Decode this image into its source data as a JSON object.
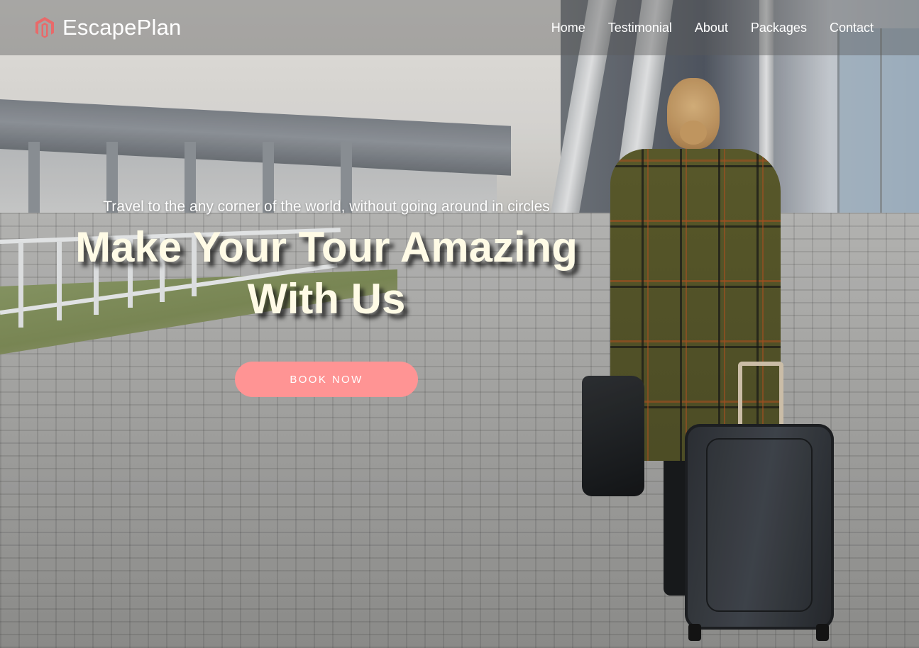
{
  "brand": {
    "name": "EscapePlan",
    "logo_icon": "magento-style-hexagon-icon",
    "logo_color": "#e86a6a"
  },
  "nav": {
    "items": [
      {
        "label": "Home"
      },
      {
        "label": "Testimonial"
      },
      {
        "label": "About"
      },
      {
        "label": "Packages"
      },
      {
        "label": "Contact"
      }
    ]
  },
  "hero": {
    "tagline": "Travel to the any corner of the world, without going around in circles",
    "headline_line1": "Make Your Tour Amazing",
    "headline_line2": "With Us",
    "cta_label": "BOOK NOW",
    "cta_color": "#ff9494",
    "background": "photo-woman-with-suitcase-at-airport"
  }
}
